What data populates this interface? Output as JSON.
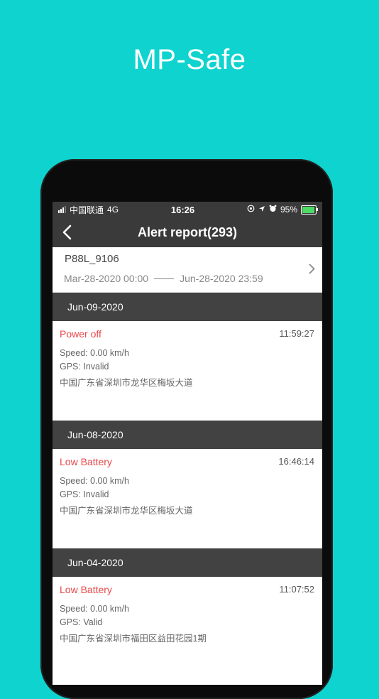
{
  "promo": {
    "title": "MP-Safe"
  },
  "status_bar": {
    "carrier": "中国联通",
    "network": "4G",
    "time": "16:26",
    "battery": "95%",
    "battery_level": 0.95
  },
  "nav": {
    "title": "Alert report(293)"
  },
  "filter": {
    "device": "P88L_9106",
    "start": "Mar-28-2020  00:00",
    "end": "Jun-28-2020  23:59"
  },
  "groups": [
    {
      "date": "Jun-09-2020",
      "alert": {
        "type": "Power off",
        "time": "11:59:27",
        "speed": "Speed: 0.00 km/h",
        "gps": "GPS: Invalid",
        "address": "中国广东省深圳市龙华区梅坂大道"
      }
    },
    {
      "date": "Jun-08-2020",
      "alert": {
        "type": "Low Battery",
        "time": "16:46:14",
        "speed": "Speed: 0.00 km/h",
        "gps": "GPS: Invalid",
        "address": "中国广东省深圳市龙华区梅坂大道"
      }
    },
    {
      "date": "Jun-04-2020",
      "alert": {
        "type": "Low Battery",
        "time": "11:07:52",
        "speed": "Speed: 0.00 km/h",
        "gps": "GPS: Valid",
        "address": "中国广东省深圳市福田区益田花园1期"
      }
    }
  ],
  "colors": {
    "background": "#0fd3cf",
    "alert_type": "#e8484a",
    "header": "#3a3a3a"
  }
}
